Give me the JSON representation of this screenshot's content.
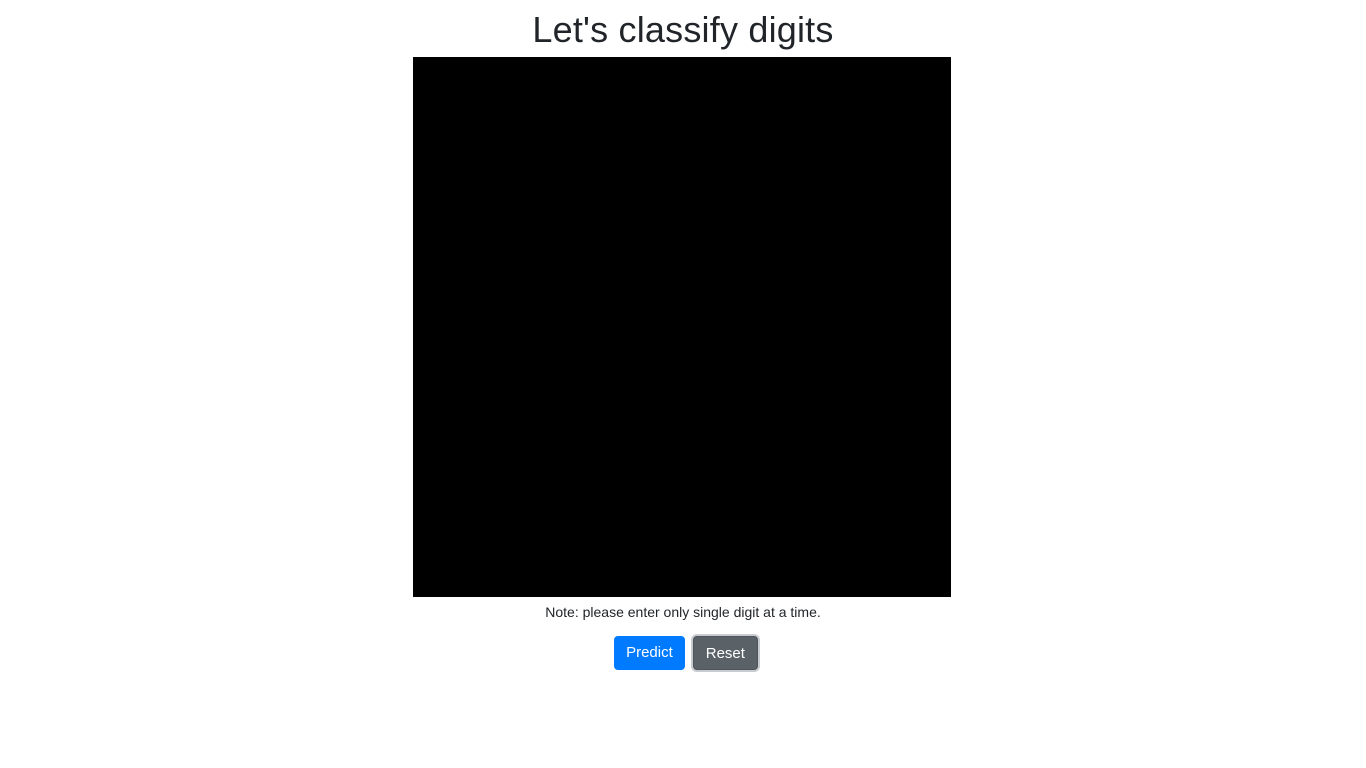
{
  "header": {
    "title": "Let's classify digits"
  },
  "drawing_canvas": {
    "background_color": "#000000"
  },
  "note": {
    "text": "Note: please enter only single digit at a time."
  },
  "actions": {
    "predict_label": "Predict",
    "reset_label": "Reset",
    "predict_color": "#007bff",
    "reset_color": "#5a6268"
  }
}
